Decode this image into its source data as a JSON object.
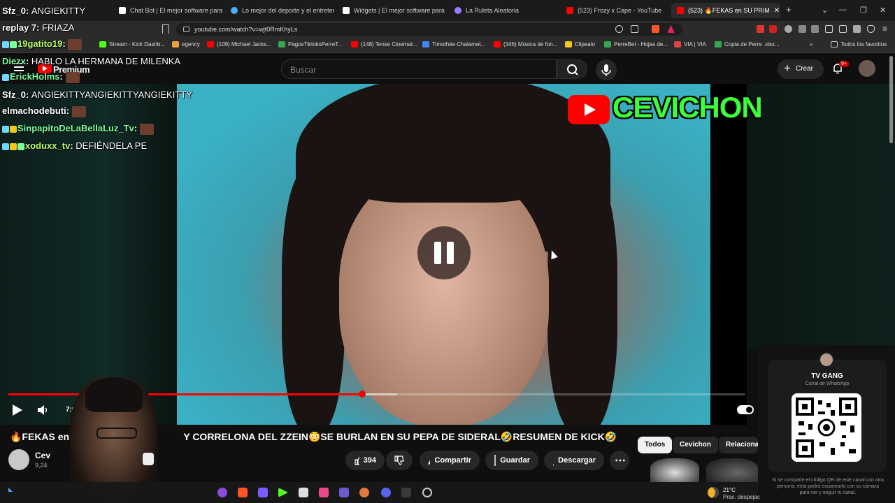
{
  "browser": {
    "tabs": [
      {
        "label": "Chat Bot | El mejor software para p",
        "color": "#ffffff"
      },
      {
        "label": "Lo mejor del deporte y el entretenim",
        "color": "#4ab0ff"
      },
      {
        "label": "Widgets | El mejor software para p",
        "color": "#ffffff"
      },
      {
        "label": "La Ruleta Aleatoria",
        "color": "#9a7bff"
      },
      {
        "label": "(523) Frozy x Cape - YouTube",
        "color": "#ff0000"
      },
      {
        "label": "(523) 🔥FEKAS en SU PRIM",
        "color": "#ff0000"
      }
    ],
    "url": "youtube.com/watch?v=wjt0RmKhyLs",
    "bookmarks": [
      "Stream - Kick Dashb...",
      "egency",
      "(109) Michael Jacks...",
      "PagosTiktoksPerreT...",
      "(148) Tense Cinemat...",
      "Timothée Chalamet...",
      "(346) Música de fon...",
      "Clipealo",
      "PerreBet - Hojas de...",
      "VIA | VIA",
      "Copia de Perre .xlsx...",
      "Todos los favoritos"
    ]
  },
  "youtube": {
    "logo_text": "Premium",
    "search_placeholder": "Buscar",
    "create_label": "Crear",
    "notif_count": "9+",
    "video": {
      "watermark": "CEVICHON",
      "time": "7:0",
      "progress": 0.48
    },
    "title": "🔥FEKAS en S",
    "title_tail": "Y CORRELONA DEL ZZEIN😳SE BURLAN EN SU PEPA DE SIDERAL🤣RESUMEN DE KICK🤣",
    "channel_name": "Cev",
    "channel_subs": "9,24",
    "likes": "394",
    "share_label": "Compartir",
    "save_label": "Guardar",
    "download_label": "Descargar",
    "chips": [
      "Todos",
      "Cevichon",
      "Relaciona"
    ]
  },
  "chat": [
    {
      "user": "Sfz_0",
      "msg": "ANGIEKITTY"
    },
    {
      "user": "replay 7",
      "msg": "FRIAZA"
    },
    {
      "user": "19gatito19",
      "msg": ""
    },
    {
      "user": "Diezx",
      "msg": "HABLO LA HERMANA DE MILENKA"
    },
    {
      "user": "ErickHolms",
      "msg": ""
    },
    {
      "user": "Sfz_0",
      "msg": "ANGIEKITTYANGIEKITTYANGIEKITTY"
    },
    {
      "user": "elmachodebuti",
      "msg": ""
    },
    {
      "user": "SinpapitoDeLaBellaLuz_Tv",
      "msg": ""
    },
    {
      "user": "xoduxx_tv",
      "msg": "DEFIÉNDELA PE"
    }
  ],
  "qr_widget": {
    "title": "TV GANG",
    "subtitle": "Canal de WhatsApp",
    "caption": "Si se comparte el código QR de este canal con otra persona, esta podrá escanearlo con su cámara para ver y seguir tu canal."
  },
  "weather": {
    "temp": "21°C",
    "desc": "Prac. despejac"
  }
}
